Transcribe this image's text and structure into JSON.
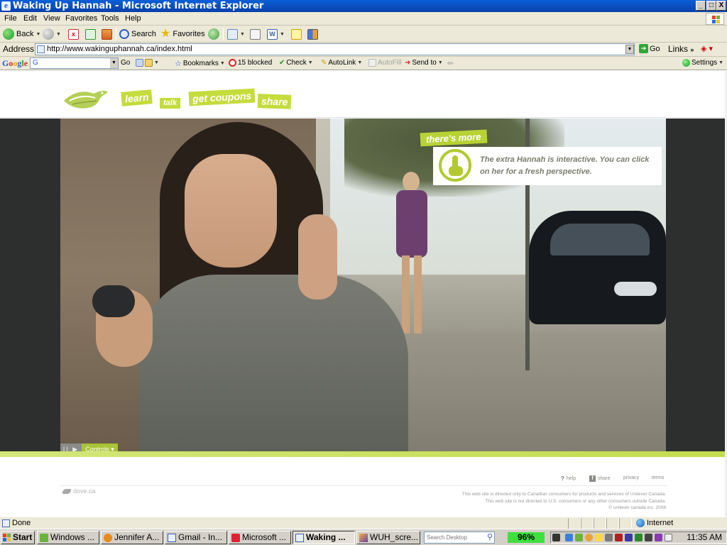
{
  "window": {
    "title": "Waking Up Hannah - Microsoft Internet Explorer",
    "icon": "ie-icon",
    "controls": {
      "minimize": "_",
      "maximize": "□",
      "close": "X"
    }
  },
  "menu": {
    "items": [
      "File",
      "Edit",
      "View",
      "Favorites",
      "Tools",
      "Help"
    ]
  },
  "toolbar": {
    "back": "Back",
    "search": "Search",
    "favorites": "Favorites"
  },
  "address": {
    "label": "Address",
    "url": "http://www.wakinguphannah.ca/index.html",
    "go": "Go",
    "links": "Links"
  },
  "google_toolbar": {
    "logo": [
      "G",
      "o",
      "o",
      "g",
      "l",
      "e"
    ],
    "search_value": "G",
    "go": "Go",
    "bookmarks": "Bookmarks",
    "blocked": "15 blocked",
    "check": "Check",
    "autolink": "AutoLink",
    "autofill": "AutoFill",
    "send_to": "Send to",
    "settings": "Settings"
  },
  "site": {
    "nav": {
      "learn": "learn",
      "talk": "talk",
      "get_coupons": "get coupons",
      "share": "share"
    },
    "callout": {
      "tag": "there's more",
      "text": "The extra Hannah is interactive. You can click on her for a fresh perspective."
    },
    "video_controls": {
      "playpause": "II ▶",
      "controls": "Controls ▾"
    },
    "footer": {
      "help": "help",
      "share": "share",
      "privacy": "privacy",
      "terms": "terms",
      "brand": "dove.ca",
      "legal": [
        "This web site is directed only to Canadian consumers for products and services of Unilever Canada.",
        "This web site is not directed to U.S. consumers or any other consumers outside Canada.",
        "© unilever canada inc. 2008"
      ]
    },
    "accent_color": "#c4dc3c"
  },
  "status": {
    "text": "Done",
    "zone": "Internet"
  },
  "taskbar": {
    "start": "Start",
    "tasks": [
      "Windows ...",
      "Jennifer A...",
      "Gmail - In...",
      "Microsoft ...",
      "Waking ...",
      "WUH_scre..."
    ],
    "active_task_index": 4,
    "search_placeholder": "Search Desktop",
    "battery": "96%",
    "clock": "11:35 AM"
  }
}
